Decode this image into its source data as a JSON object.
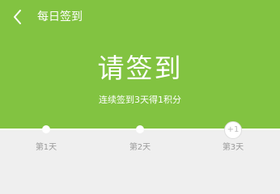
{
  "header": {
    "back_icon": "chevron-left-icon",
    "title": "每日签到"
  },
  "hero": {
    "background": "#82c341",
    "title": "请签到",
    "subtitle": "连续签到3天得1积分"
  },
  "progress": {
    "days": [
      {
        "label": "第1天"
      },
      {
        "label": "第2天"
      },
      {
        "label": "第3天",
        "reward": "+1"
      }
    ]
  }
}
